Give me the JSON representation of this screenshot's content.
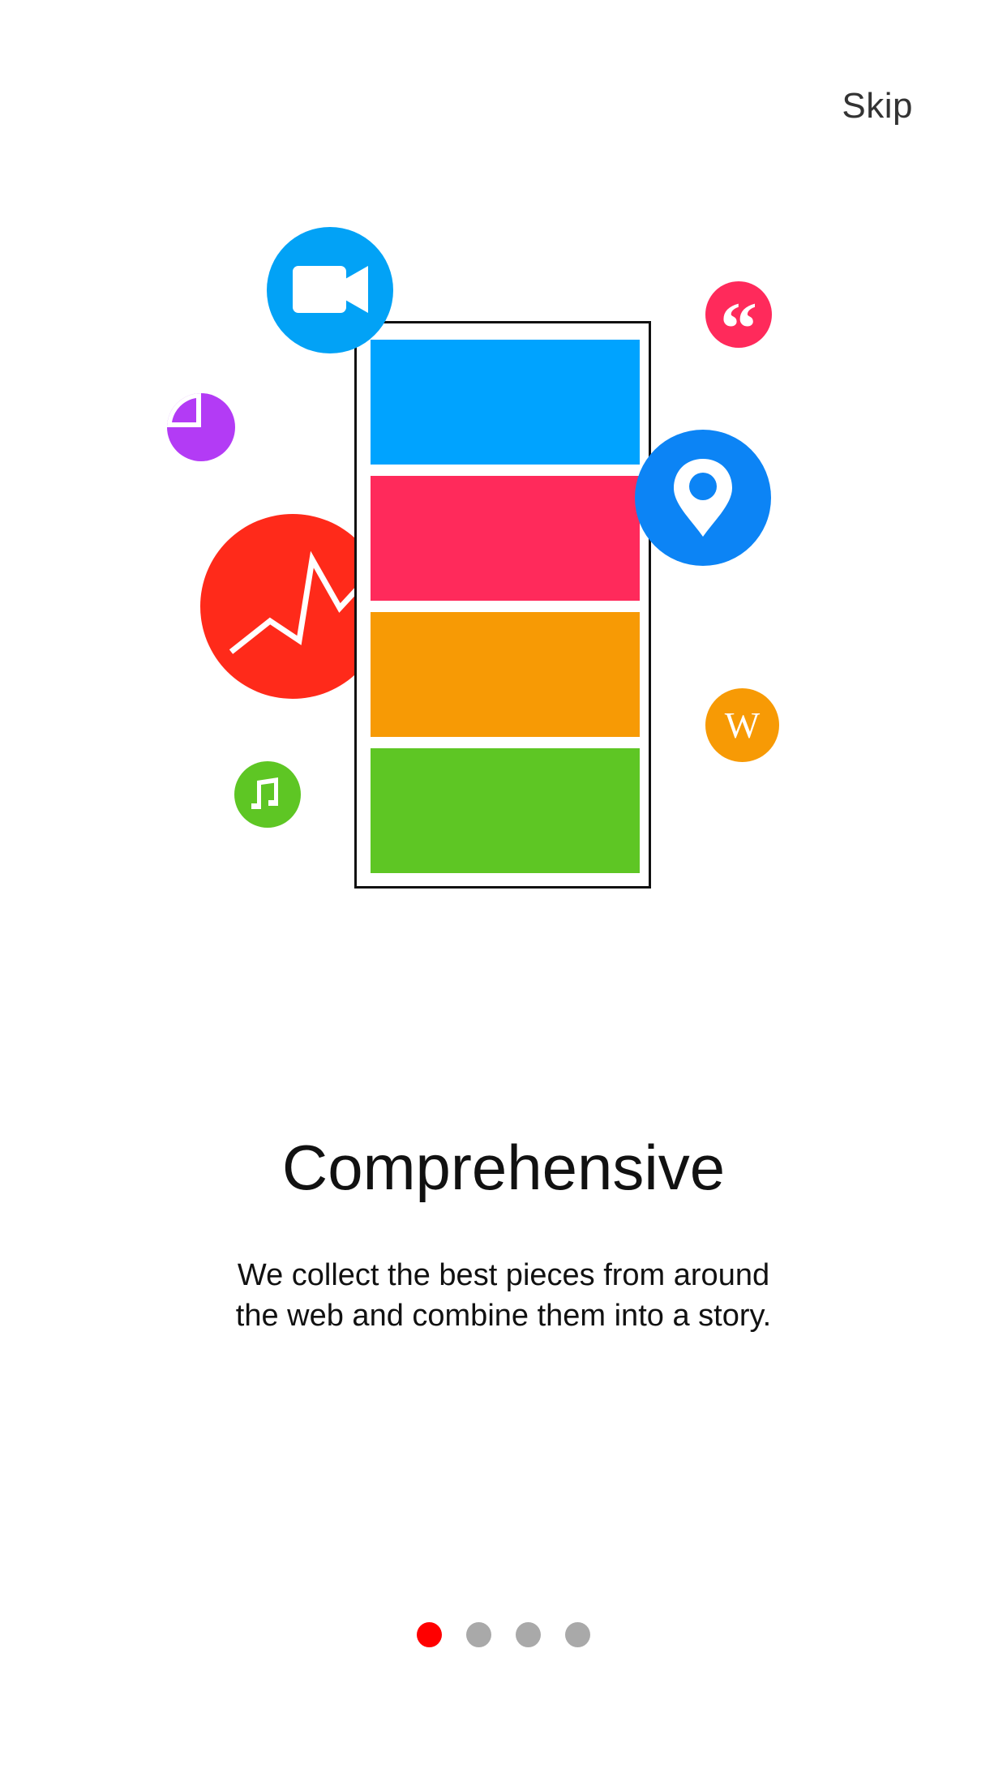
{
  "header": {
    "skip_label": "Skip"
  },
  "illustration": {
    "cards": [
      {
        "color": "#00A3FF"
      },
      {
        "color": "#FF2A5B"
      },
      {
        "color": "#F79A05"
      },
      {
        "color": "#5EC624"
      }
    ],
    "icons": [
      {
        "name": "video-camera-icon",
        "color": "#02A2F6"
      },
      {
        "name": "pie-chart-icon",
        "color": "#B33BF5"
      },
      {
        "name": "line-chart-icon",
        "color": "#FF2A1A"
      },
      {
        "name": "music-note-icon",
        "color": "#5EC624"
      },
      {
        "name": "quote-icon",
        "color": "#FF2A5B"
      },
      {
        "name": "map-pin-icon",
        "color": "#0C84F5"
      },
      {
        "name": "wikipedia-icon",
        "color": "#F79A05"
      }
    ],
    "quote_glyph": "“",
    "wiki_glyph": "W"
  },
  "content": {
    "title": "Comprehensive",
    "description_line1": "We collect the best pieces from around",
    "description_line2": "the web and combine them into a story."
  },
  "pagination": {
    "total_pages": 4,
    "current_page": 1,
    "active_color": "#FF0000",
    "inactive_color": "#A9A9A9"
  }
}
